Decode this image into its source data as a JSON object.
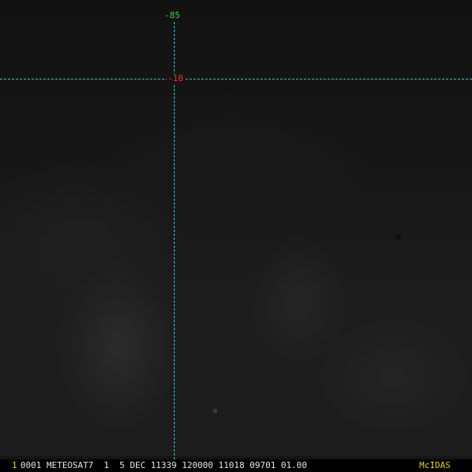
{
  "imagery": {
    "crosshair_color": "#3cc8d2",
    "background_color": "#151515"
  },
  "labels": {
    "latitude": "-10",
    "latitude_color": "#ff2a2a",
    "longitude": "-85",
    "longitude_color": "#2fd24a"
  },
  "status_bar": {
    "frame_number": "1",
    "info": "0001 METEOSAT7  1  5 DEC 11339 120000 11018 09701 01.00",
    "logo": "McIDAS",
    "accent_color": "#e8d400"
  }
}
